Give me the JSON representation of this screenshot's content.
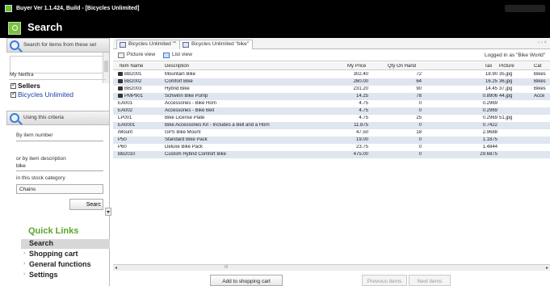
{
  "window": {
    "title": "Buyer Ver 1.1.424, Build  - [Bicycles Unlimited]"
  },
  "header": {
    "title": "Search"
  },
  "sidebar": {
    "search_panel_label": "Search for items from these sel",
    "netfira_label": "My Netfira",
    "sellers_label": "Sellers",
    "seller_item": "Bicycles Unlimited",
    "criteria_panel_label": "Using this criteria",
    "item_number_label": "By item number",
    "item_number_value": "",
    "description_label": "or by item description",
    "description_value": "bike",
    "category_label": "in this stock category",
    "category_value": "Chains",
    "search_button": "Searc",
    "quick_links_title": "Quick Links",
    "quick_links": [
      "Search",
      "Shopping cart",
      "General functions",
      "Settings"
    ]
  },
  "tabs": [
    "Bicycles Unlimited \"\"",
    "Bicycles Unlimited \"bike\""
  ],
  "tab_scroll": "‹ › ×",
  "toolbar": {
    "picture_view": "Picture view",
    "list_view": "List view",
    "logged_in": "Logged in as \"Bike World\""
  },
  "table": {
    "columns": [
      "Item Name",
      "Description",
      "My Price",
      "Qty On Hand",
      "Tax",
      "Picture",
      "Cat"
    ],
    "rows": [
      {
        "item": "BB2001",
        "desc": "Mountain Bike",
        "price": "302.40",
        "qty": "72",
        "tax": "18.90",
        "pic": "35.jpg",
        "cat": "Bikes",
        "icon": true
      },
      {
        "item": "BB2002",
        "desc": "Comfort Bike",
        "price": "260.00",
        "qty": "64",
        "tax": "16.25",
        "pic": "36.jpg",
        "cat": "Bikes",
        "icon": true
      },
      {
        "item": "BB2003",
        "desc": "Hybrid Bike",
        "price": "231.20",
        "qty": "90",
        "tax": "14.45",
        "pic": "37.jpg",
        "cat": "Bikes",
        "icon": true
      },
      {
        "item": "PMP901",
        "desc": "Schwinn Bike Pump",
        "price": "14.25",
        "qty": "78",
        "tax": "0.8906",
        "pic": "44.jpg",
        "cat": "Acce",
        "icon": true
      },
      {
        "item": "EA001",
        "desc": "Accessories - Bike Horn",
        "price": "4.75",
        "qty": "0",
        "tax": "0.2969",
        "pic": "",
        "cat": "",
        "icon": false
      },
      {
        "item": "EA002",
        "desc": "Accessories - Bike Bell",
        "price": "4.75",
        "qty": "0",
        "tax": "0.2969",
        "pic": "",
        "cat": "",
        "icon": false
      },
      {
        "item": "LP001",
        "desc": "Bike License Plate",
        "price": "4.75",
        "qty": "25",
        "tax": "0.2969",
        "pic": "51.jpg",
        "cat": "",
        "icon": false
      },
      {
        "item": "EA0001",
        "desc": "Bike Accessories Kit - Includes a Bell and a Horn",
        "price": "11.875",
        "qty": "0",
        "tax": "0.7422",
        "pic": "",
        "cat": "",
        "icon": false
      },
      {
        "item": "iMount",
        "desc": "GPS Bike Mount",
        "price": "47.50",
        "qty": "18",
        "tax": "2.9688",
        "pic": "",
        "cat": "",
        "icon": false
      },
      {
        "item": "P50",
        "desc": "Standard Bike Pack",
        "price": "19.00",
        "qty": "0",
        "tax": "1.1875",
        "pic": "",
        "cat": "",
        "icon": false
      },
      {
        "item": "P60",
        "desc": "Deluxe Bike Pack",
        "price": "23.75",
        "qty": "0",
        "tax": "1.4844",
        "pic": "",
        "cat": "",
        "icon": false
      },
      {
        "item": "BB2010",
        "desc": "Custom Hybrid Comfort Bike",
        "price": "475.00",
        "qty": "0",
        "tax": "29.6875",
        "pic": "",
        "cat": "",
        "icon": false
      }
    ]
  },
  "scroll_grip": "III",
  "buttons": {
    "add_to_cart": "Add to shopping cart",
    "previous": "Previous items",
    "next": "Next items"
  }
}
